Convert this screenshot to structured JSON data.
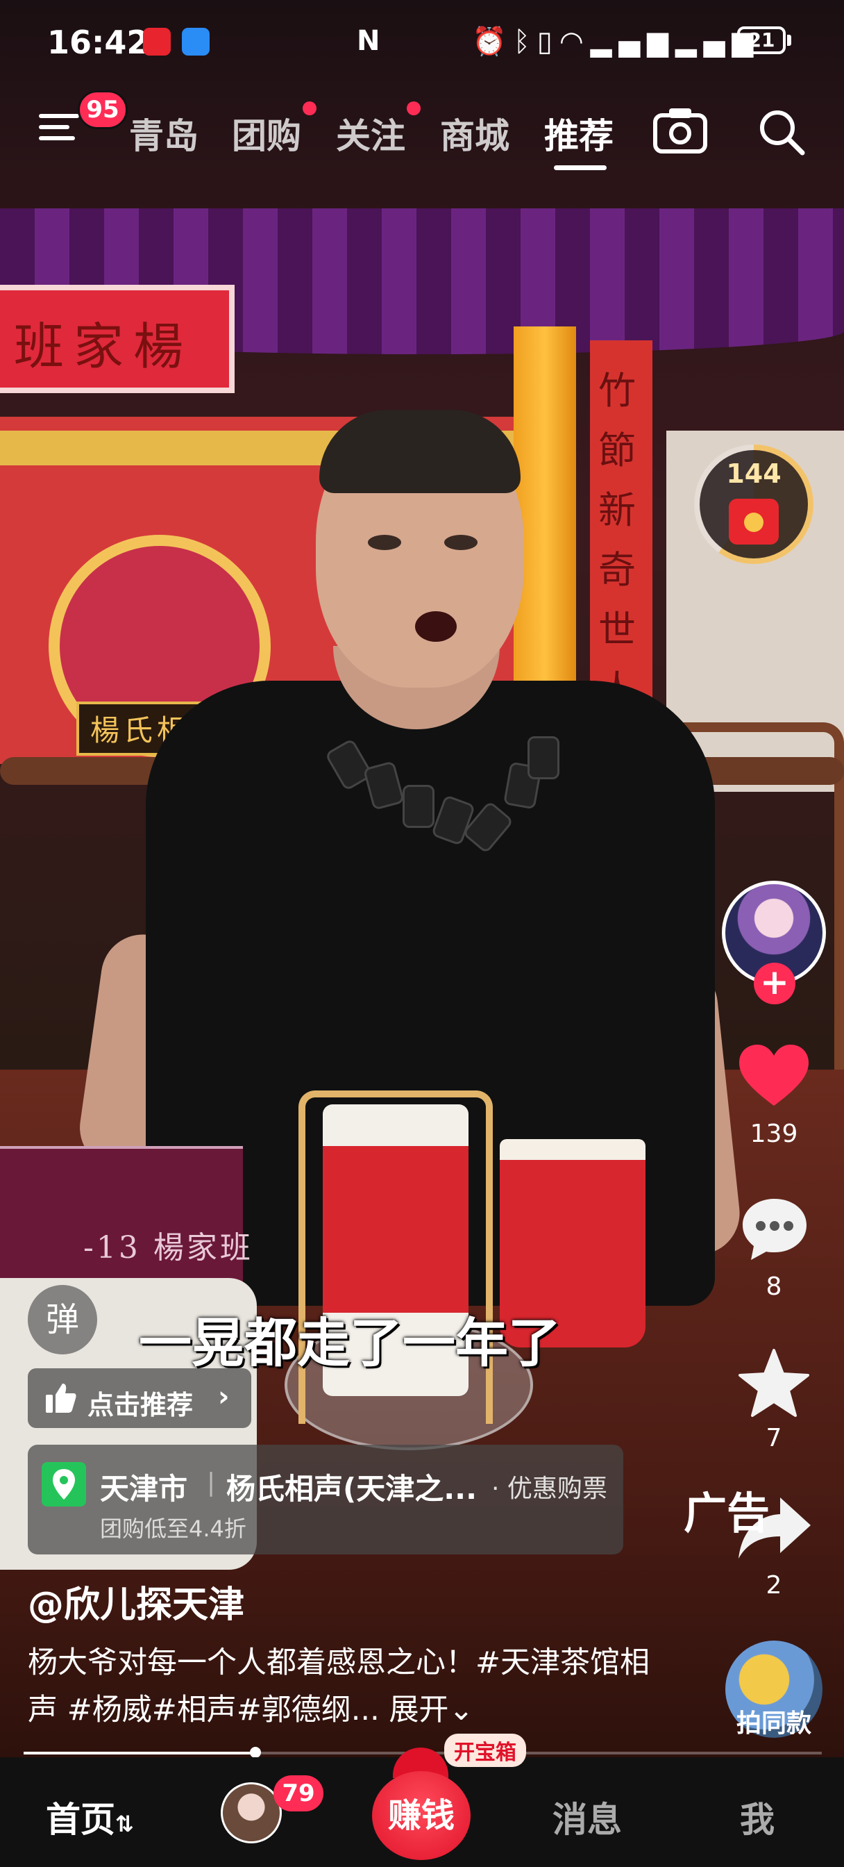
{
  "status_bar": {
    "time": "16:42",
    "battery": "21",
    "icons": [
      "alarm-icon",
      "bluetooth-icon",
      "vibrate-icon",
      "wifi-icon",
      "signal-icon",
      "signal-icon"
    ]
  },
  "top_nav": {
    "menu_badge": "95",
    "tabs": [
      {
        "label": "青岛",
        "dot": false
      },
      {
        "label": "团购",
        "dot": true
      },
      {
        "label": "关注",
        "dot": true
      },
      {
        "label": "商城",
        "dot": false
      },
      {
        "label": "推荐",
        "dot": false,
        "active": true
      }
    ]
  },
  "video": {
    "plaque_text": "班家楊",
    "stage_sign": "楊氏相聲",
    "couplet": "竹節新奇世人爱杯",
    "table_sign": "-13 楊家班",
    "subtitle": "一晃都走了一年了"
  },
  "side_actions": {
    "reward_count": "144",
    "like_count": "139",
    "comment_count": "8",
    "favorite_count": "7",
    "share_count": "2",
    "ad_label": "广告",
    "same_style_label": "拍同款"
  },
  "overlay": {
    "danmu_label": "弹",
    "recommend_label": "点击推荐",
    "location": {
      "city": "天津市",
      "separator": "|",
      "venue": "杨氏相声(天津之...",
      "deal": "· 优惠购票",
      "sub": "团购低至4.4折"
    },
    "author": "@欣儿探天津",
    "caption": "杨大爷对每一个人都着感恩之心！#天津茶馆相声 #杨威#相声#郭德纲...",
    "expand": "展开",
    "progress": 0.29
  },
  "bottom_bar": {
    "home": "首页",
    "friends_badge": "79",
    "earn": "赚钱",
    "treasure": "开宝箱",
    "messages": "消息",
    "me": "我"
  },
  "colors": {
    "accent": "#ff2c55",
    "gold": "#f3c36a",
    "pin": "#25c45a"
  }
}
